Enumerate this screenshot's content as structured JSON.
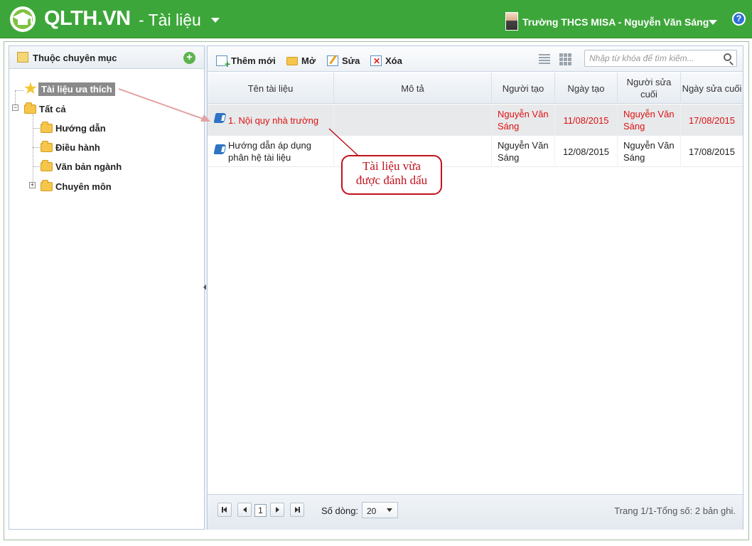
{
  "header": {
    "brand": "QLTH.VN",
    "module": "- Tài liệu",
    "user": "Trường THCS MISA - Nguyễn Văn Sáng",
    "help": "?"
  },
  "sidebar": {
    "title": "Thuộc chuyên mục",
    "items": [
      {
        "label": "Tài liệu ưa thích"
      },
      {
        "label": "Tất cả"
      },
      {
        "label": "Hướng dẫn"
      },
      {
        "label": "Điều hành"
      },
      {
        "label": "Văn bản ngành"
      },
      {
        "label": "Chuyên môn"
      }
    ]
  },
  "toolbar": {
    "add": "Thêm mới",
    "open": "Mở",
    "edit": "Sửa",
    "delete": "Xóa",
    "search_placeholder": "Nhập từ khóa để tìm kiếm..."
  },
  "table": {
    "columns": [
      "Tên tài liệu",
      "Mô tả",
      "Người tạo",
      "Ngày tạo",
      "Người sửa cuối",
      "Ngày sửa cuối"
    ],
    "rows": [
      {
        "name": "1. Nội quy nhà trường",
        "desc": "",
        "creator": "Nguyễn Văn Sáng",
        "created": "11/08/2015",
        "editor": "Nguyễn Văn Sáng",
        "edited": "17/08/2015"
      },
      {
        "name": "Hướng dẫn áp dụng phân hệ tài liệu",
        "desc": "",
        "creator": "Nguyễn Văn Sáng",
        "created": "12/08/2015",
        "editor": "Nguyễn Văn Sáng",
        "edited": "17/08/2015"
      }
    ]
  },
  "pager": {
    "page": "1",
    "rows_label": "Số dòng:",
    "rows_value": "20",
    "info": "Trang 1/1-Tổng số: 2 bản ghi."
  },
  "annotation": {
    "line1": "Tài liệu vừa",
    "line2": "được đánh dấu"
  },
  "colors": {
    "header_green": "#3da63a",
    "highlight_red": "#d11111",
    "annotation_red": "#c0121c"
  }
}
